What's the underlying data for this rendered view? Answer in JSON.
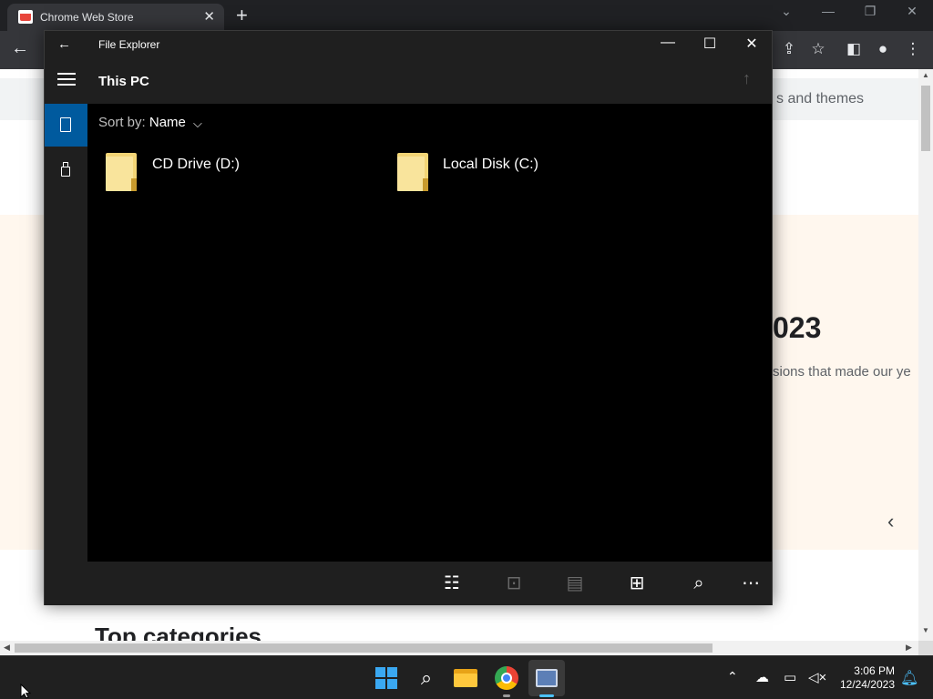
{
  "browser": {
    "tab_title": "Chrome Web Store",
    "tab_close": "✕",
    "new_tab": "+",
    "window_controls": {
      "dropdown": "⌄",
      "minimize": "—",
      "restore": "❐",
      "close": "✕"
    },
    "toolbar": {
      "back": "←",
      "share": "⇪",
      "bookmark": "☆",
      "sidepanel": "◧",
      "profile": "●",
      "menu": "⋮"
    },
    "page": {
      "subtitle_fragment": "s and themes",
      "year_fragment": "023",
      "desc_fragment": "sions that made our ye",
      "carousel_prev": "‹",
      "section_heading": "Top categories"
    },
    "scroll": {
      "up": "▲",
      "down": "▼",
      "left": "◀",
      "right": "▶"
    }
  },
  "explorer": {
    "title": "File Explorer",
    "back": "←",
    "controls": {
      "minimize": "—",
      "maximize": "☐",
      "close": "✕"
    },
    "location": "This PC",
    "up": "↑",
    "sort_label": "Sort by:",
    "sort_value": "Name",
    "sort_chevron": "⌵",
    "drives": [
      {
        "label": "CD Drive (D:)"
      },
      {
        "label": "Local Disk (C:)"
      }
    ],
    "commands": {
      "select": "☷",
      "new": "⊡",
      "paste": "▤",
      "view": "⊞",
      "search": "⌕",
      "more": "⋯"
    }
  },
  "taskbar": {
    "search_icon": "⌕",
    "tray_chevron": "⌃",
    "time": "3:06 PM",
    "date": "12/24/2023",
    "accent": "#4cc2ff"
  }
}
